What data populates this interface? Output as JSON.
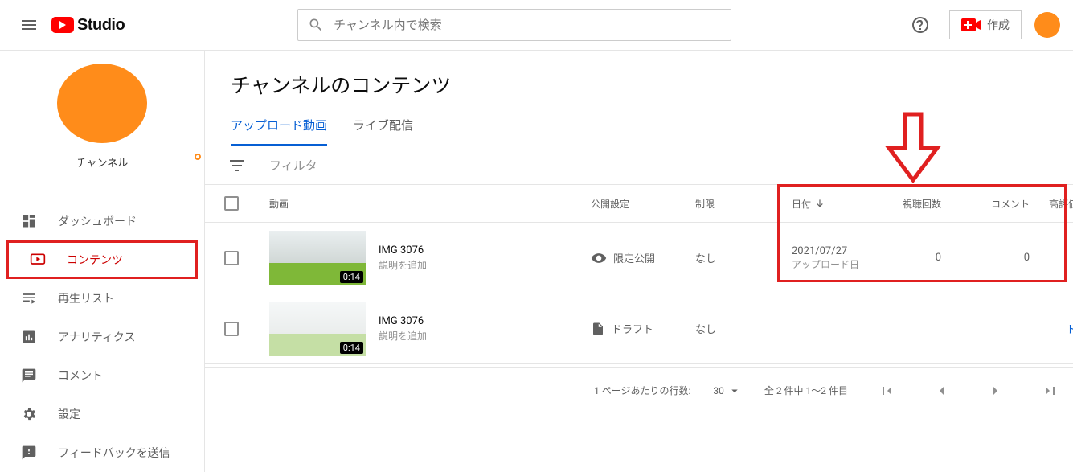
{
  "header": {
    "logo_text": "Studio",
    "search_placeholder": "チャンネル内で検索",
    "create_button": "作成"
  },
  "sidebar": {
    "channel_label": "チャンネル",
    "items": [
      {
        "label": "ダッシュボード",
        "icon": "dashboard"
      },
      {
        "label": "コンテンツ",
        "icon": "content",
        "active": true,
        "boxed": true
      },
      {
        "label": "再生リスト",
        "icon": "playlist"
      },
      {
        "label": "アナリティクス",
        "icon": "analytics"
      },
      {
        "label": "コメント",
        "icon": "comments"
      },
      {
        "label": "設定",
        "icon": "settings"
      },
      {
        "label": "フィードバックを送信",
        "icon": "feedback"
      }
    ]
  },
  "main": {
    "page_title": "チャンネルのコンテンツ",
    "tabs": [
      {
        "label": "アップロード動画",
        "active": true
      },
      {
        "label": "ライブ配信"
      }
    ],
    "filter_label": "フィルタ",
    "columns": {
      "video": "動画",
      "visibility": "公開設定",
      "restrictions": "制限",
      "date": "日付",
      "views": "視聴回数",
      "comments": "コメント",
      "likes": "高評価率（低"
    },
    "rows": [
      {
        "title": "IMG 3076",
        "desc": "説明を追加",
        "duration": "0:14",
        "visibility_label": "限定公開",
        "visibility_icon": "unlisted",
        "restrictions": "なし",
        "date": "2021/07/27",
        "date_sub": "アップロード日",
        "views": "0",
        "comments": "0",
        "draft": false
      },
      {
        "title": "IMG 3076",
        "desc": "説明を追加",
        "duration": "0:14",
        "visibility_label": "ドラフト",
        "visibility_icon": "draft",
        "restrictions": "なし",
        "date": "",
        "date_sub": "",
        "views": "",
        "comments": "",
        "draft": true,
        "draft_action": "ドラフトを編"
      }
    ],
    "paginator": {
      "rows_label": "1 ページあたりの行数:",
      "rows_value": "30",
      "range_text": "全 2 件中 1～2 件目"
    }
  }
}
